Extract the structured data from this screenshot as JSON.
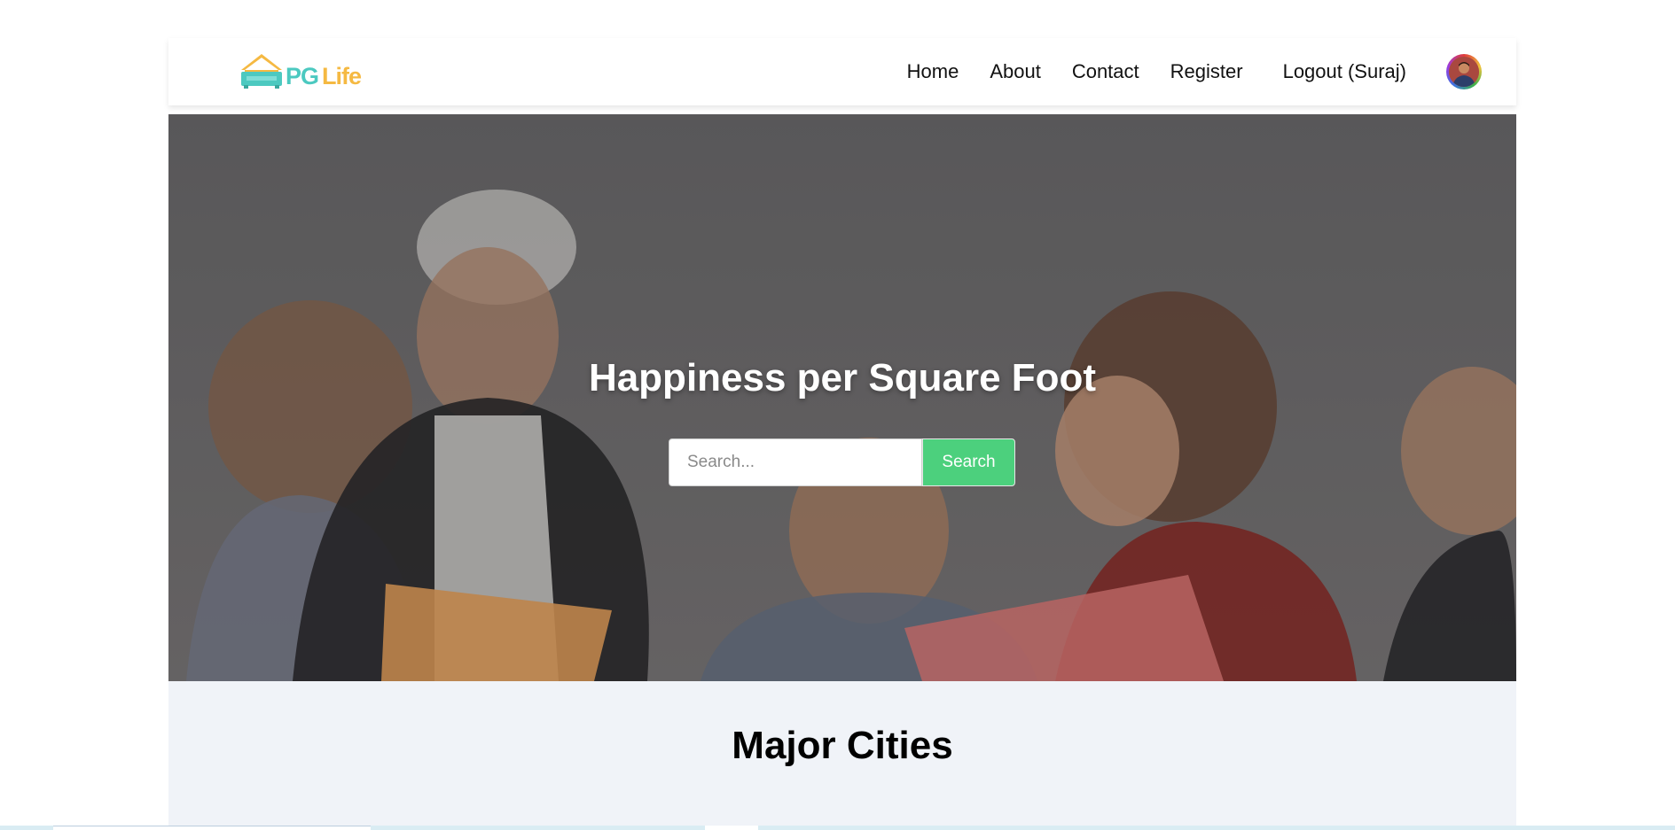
{
  "brand": {
    "logo_primary": "PG",
    "logo_secondary": "Life",
    "colors": {
      "teal": "#4cc9c0",
      "yellow": "#f5b942"
    }
  },
  "nav": {
    "links": [
      "Home",
      "About",
      "Contact",
      "Register"
    ],
    "logout_label": "Logout (Suraj)",
    "avatar_icon": "user-avatar"
  },
  "hero": {
    "title": "Happiness per Square Foot",
    "search_placeholder": "Search...",
    "search_button": "Search",
    "button_color": "#4cd07d"
  },
  "cities": {
    "title": "Major Cities"
  }
}
